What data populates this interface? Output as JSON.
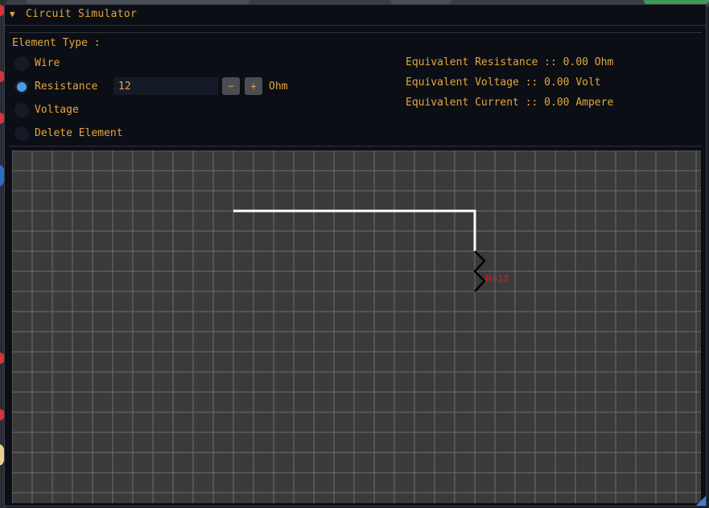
{
  "window": {
    "title": "Circuit Simulator"
  },
  "element_type": {
    "label": "Element Type :",
    "options": [
      {
        "label": "Wire",
        "selected": false
      },
      {
        "label": "Resistance",
        "selected": true
      },
      {
        "label": "Voltage",
        "selected": false
      },
      {
        "label": "Delete Element",
        "selected": false
      }
    ],
    "resistance_value": "12",
    "minus_label": "−",
    "plus_label": "+",
    "unit": "Ohm"
  },
  "equivalent": {
    "resistance": "Equivalent Resistance :: 0.00 Ohm",
    "voltage": "Equivalent Voltage :: 0.00 Volt",
    "current": "Equivalent Current :: 0.00 Ampere"
  },
  "circuit": {
    "resistor_label": "R=12"
  },
  "colors": {
    "accent": "#e6a63a",
    "radio_active": "#4a9be8",
    "grid_bg": "#3a3a3a",
    "grid_line": "#6e6e6e",
    "wire": "#ffffff",
    "resistor": "#000000",
    "resistor_label": "#e01e1e"
  }
}
